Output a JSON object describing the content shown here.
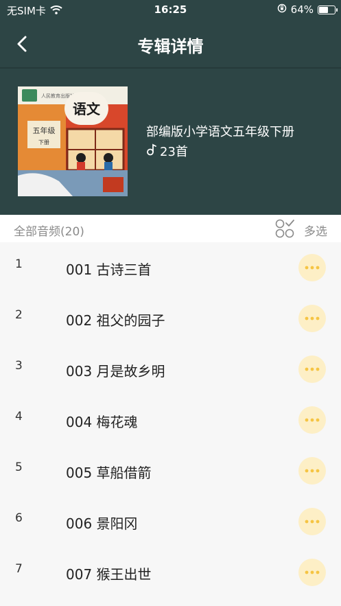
{
  "status_bar": {
    "carrier": "无SIM卡",
    "time": "16:25",
    "battery": "64%",
    "battery_level": 0.64
  },
  "nav": {
    "title": "专辑详情"
  },
  "album": {
    "cover_text": {
      "publisher": "人民教育出版社",
      "subject": "语文",
      "grade": "五年级",
      "volume": "下册"
    },
    "title": "部编版小学语文五年级下册",
    "count": "23首"
  },
  "list_header": {
    "all_label": "全部音频(20)",
    "multi_label": "多选"
  },
  "tracks": [
    {
      "num": "1",
      "title": "001 古诗三首"
    },
    {
      "num": "2",
      "title": "002 祖父的园子"
    },
    {
      "num": "3",
      "title": "003 月是故乡明"
    },
    {
      "num": "4",
      "title": "004 梅花魂"
    },
    {
      "num": "5",
      "title": "005 草船借箭"
    },
    {
      "num": "6",
      "title": "006 景阳冈"
    },
    {
      "num": "7",
      "title": "007 猴王出世"
    }
  ],
  "colors": {
    "header_bg": "#2d4545",
    "accent": "#f5c443",
    "more_bg": "#fdefc6"
  }
}
